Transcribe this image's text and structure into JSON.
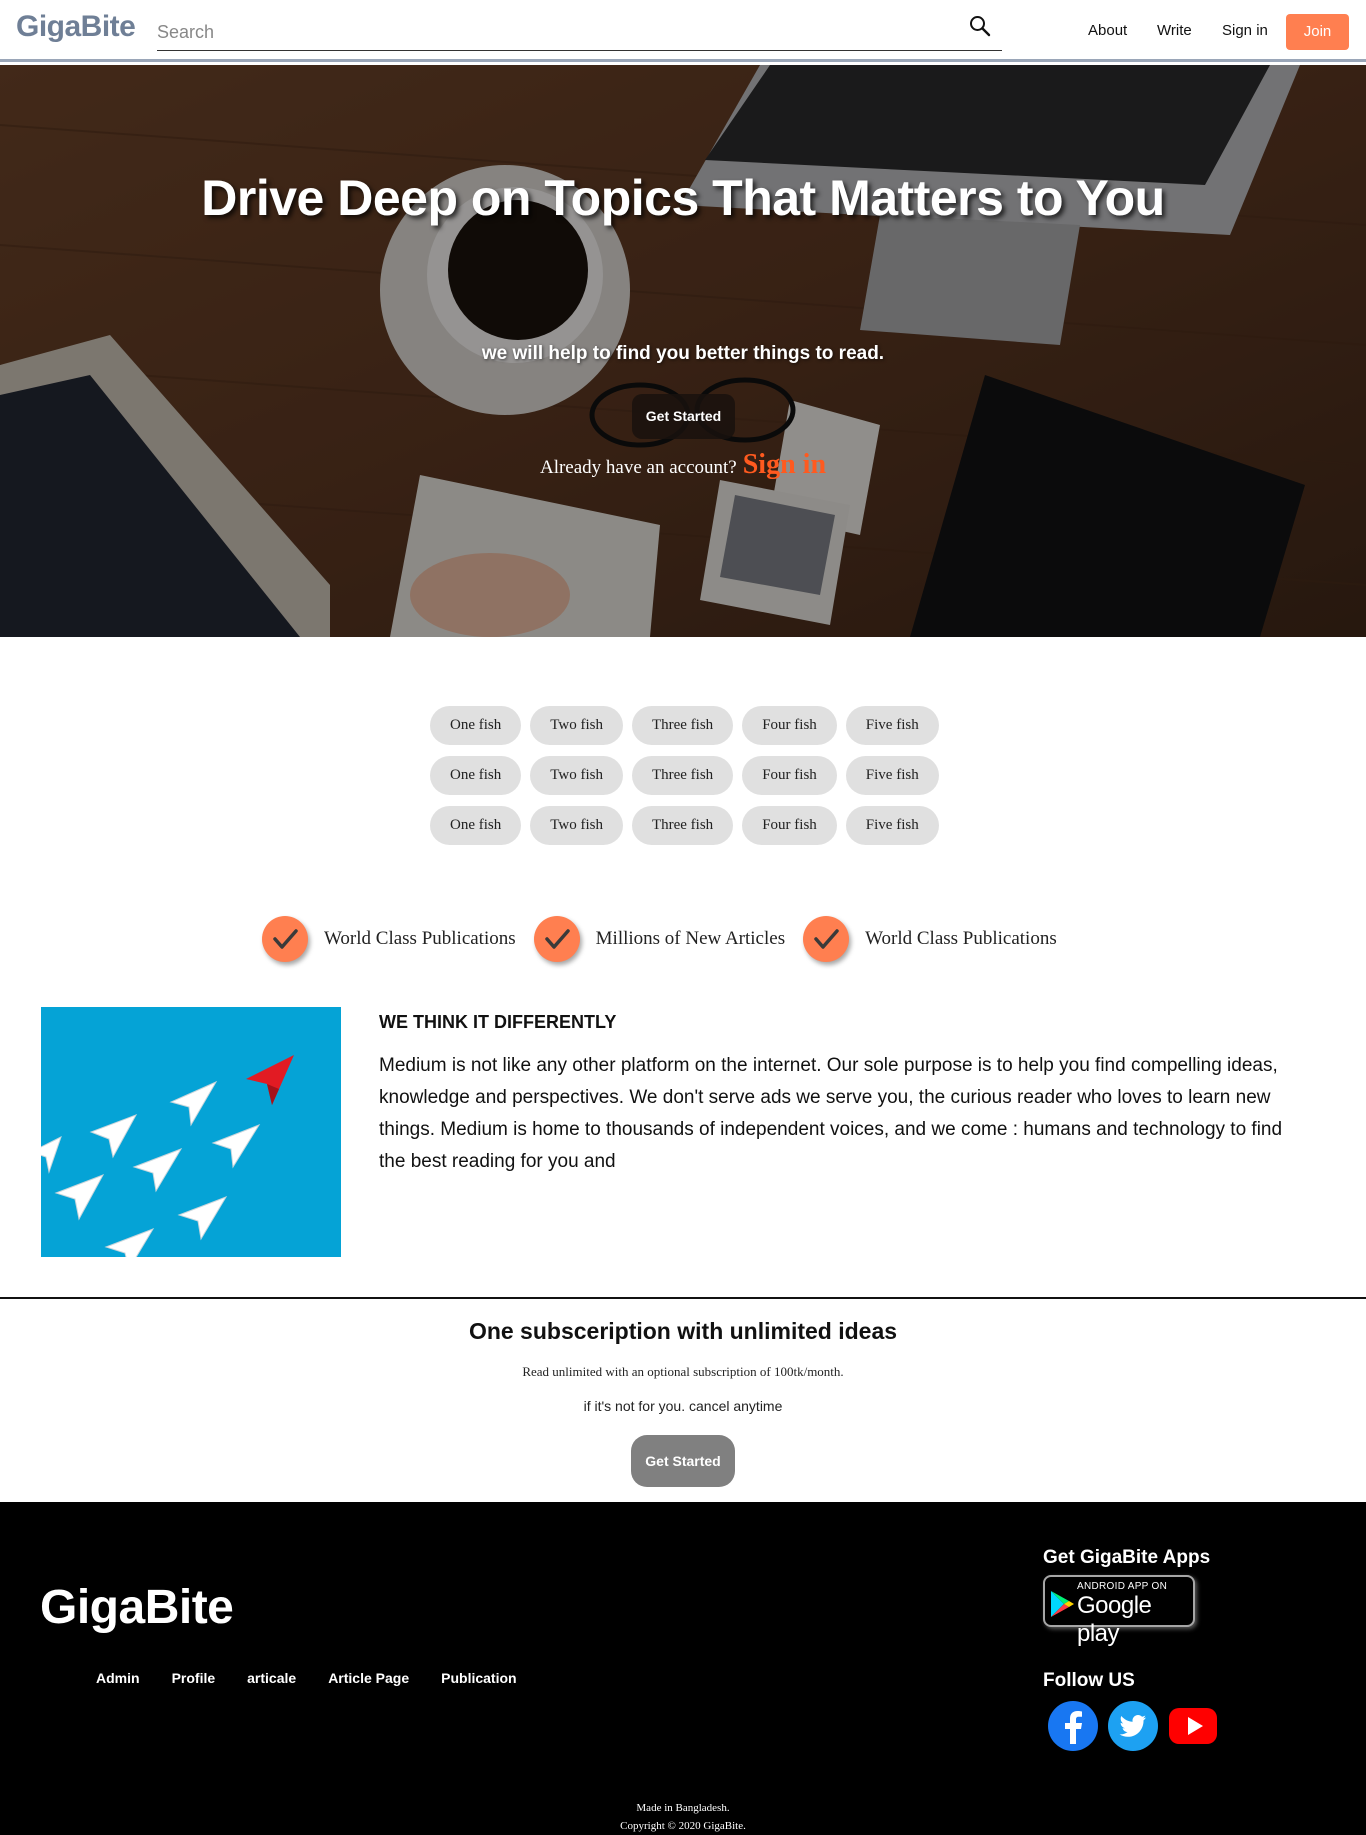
{
  "nav": {
    "brand": "GigaBite",
    "search_placeholder": "Search",
    "links": [
      "About",
      "Write",
      "Sign in"
    ],
    "join": "Join"
  },
  "hero": {
    "title": "Drive Deep on Topics That Matters to You",
    "subtitle": "we will help to find you better things to read.",
    "button": "Get Started",
    "account_prompt": "Already have an account?",
    "signin_link": "Sign in"
  },
  "pills": [
    [
      "One fish",
      "Two fish",
      "Three fish",
      "Four fish",
      "Five fish"
    ],
    [
      "One fish",
      "Two fish",
      "Three fish",
      "Four fish",
      "Five fish"
    ],
    [
      "One fish",
      "Two fish",
      "Three fish",
      "Four fish",
      "Five fish"
    ]
  ],
  "features": [
    "World Class Publications",
    "Millions of New Articles",
    "World Class Publications"
  ],
  "about": {
    "heading": "WE THINK IT DIFFERENTLY",
    "text": "Medium is not like any other platform on the internet. Our sole purpose is to help you find compelling ideas, knowledge and perspectives. We don't serve ads we serve you, the curious reader who loves to learn new things. Medium is home to thousands of independent voices, and we come : humans and technology to find the best reading for you and"
  },
  "subscription": {
    "title": "One subsceription with unlimited ideas",
    "line1": "Read unlimited with an optional subscription of 100tk/month.",
    "line2": "if it's not for you. cancel anytime",
    "button": "Get Started"
  },
  "footer": {
    "brand": "GigaBite",
    "links": [
      "Admin",
      "Profile",
      "articale",
      "Article Page",
      "Publication"
    ],
    "apps_title": "Get GigaBite Apps",
    "gplay_small": "ANDROID APP ON",
    "gplay_big": "Google play",
    "follow_title": "Follow US",
    "social_icons": [
      "facebook-icon",
      "twitter-icon",
      "youtube-icon"
    ],
    "made_in": "Made in Bangladesh.",
    "copyright": "Copyright © 2020 GigaBite."
  },
  "colors": {
    "accent": "#ff7f50",
    "brand": "#6f7f96",
    "signin_link": "#ff5a1f",
    "about_bg": "#05a3d6",
    "facebook": "#1877f2",
    "twitter": "#1da1f2",
    "youtube": "#ff0000"
  }
}
